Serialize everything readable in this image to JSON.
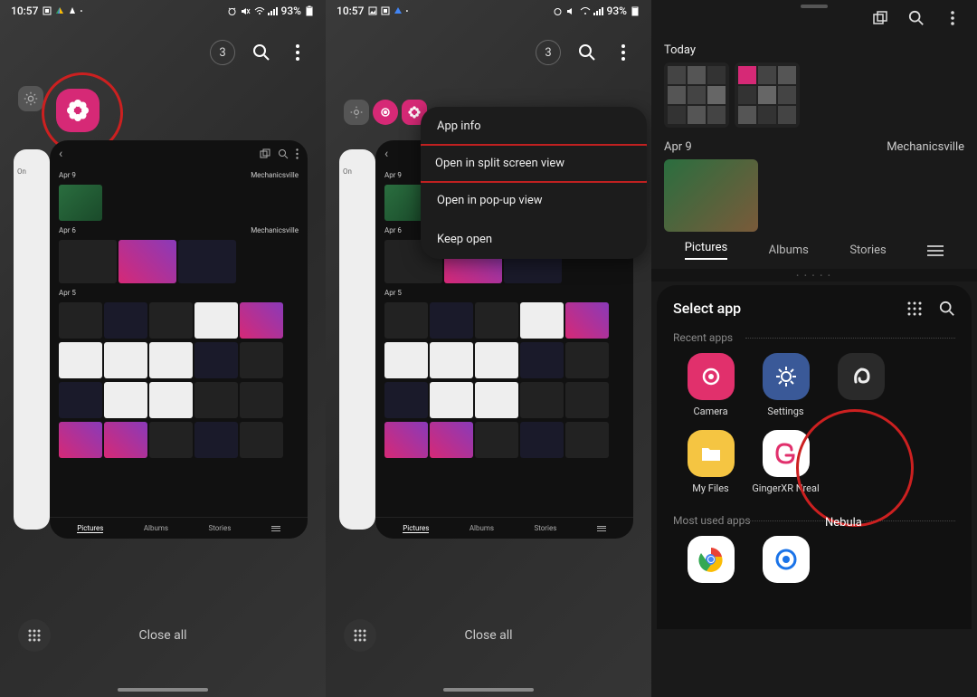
{
  "status": {
    "time": "10:57",
    "battery": "93%"
  },
  "recents": {
    "count": "3",
    "close_all": "Close all"
  },
  "gallery_card": {
    "date1": "Apr 9",
    "date2": "Apr 6",
    "date3": "Apr 5",
    "location": "Mechanicsville",
    "tabs": {
      "pictures": "Pictures",
      "albums": "Albums",
      "stories": "Stories"
    },
    "behind_label": "On"
  },
  "context_menu": {
    "app_info": "App info",
    "split": "Open in split screen view",
    "popup": "Open in pop-up view",
    "keep": "Keep open"
  },
  "p3": {
    "today": "Today",
    "date": "Apr 9",
    "location": "Mechanicsville",
    "tabs": {
      "pictures": "Pictures",
      "albums": "Albums",
      "stories": "Stories"
    }
  },
  "select_app": {
    "title": "Select app",
    "recent_label": "Recent apps",
    "most_used_label": "Most used apps",
    "apps": {
      "camera": "Camera",
      "settings": "Settings",
      "nebula": "Nebula",
      "files": "My Files",
      "ginger": "GingerXR Nreal"
    }
  }
}
